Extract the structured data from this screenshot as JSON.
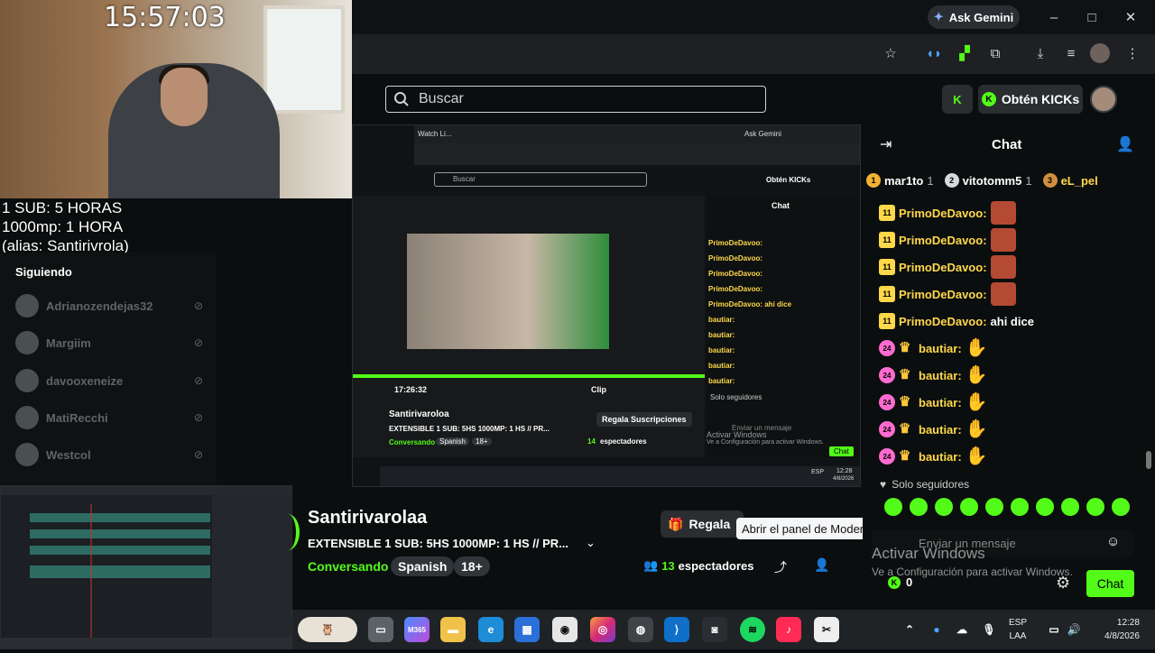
{
  "overlay": {
    "clock": "15:57:03",
    "line1": "1 SUB: 5 HORAS",
    "line2": "1000mp: 1 HORA",
    "line3": "(alias: Santirivrola)"
  },
  "sidebar": {
    "title": "Siguiendo",
    "items": [
      {
        "name": "Adrianozendejas32"
      },
      {
        "name": "Margiim"
      },
      {
        "name": "davooxeneize"
      },
      {
        "name": "MatiRecchi"
      },
      {
        "name": "Westcol"
      }
    ]
  },
  "browser": {
    "ask_gemini": "Ask Gemini",
    "window_controls": [
      "–",
      "□",
      "✕"
    ]
  },
  "kick": {
    "search_placeholder": "Buscar",
    "obten_kicks": "Obtén KICKs"
  },
  "nested": {
    "tab_label": "Watch Li...",
    "search": "Buscar",
    "ask_gemini": "Ask Gemini",
    "obten_kicks": "Obtén KICKs",
    "chat_title": "Chat",
    "streamer": "Santirivaroloa",
    "title": "EXTENSIBLE 1 SUB: 5HS 1000MP: 1 HS // PR...",
    "category": "Conversando",
    "language": "Spanish",
    "age": "18+",
    "viewers": "14",
    "viewers_label": "espectadores",
    "gift": "Regala Suscripciones",
    "time": "17:26:32",
    "clip": "Clip",
    "chat_messages": [
      "PrimoDeDavoo:",
      "PrimoDeDavoo:",
      "PrimoDeDavoo:",
      "PrimoDeDavoo:",
      "PrimoDeDavoo: ahi dice",
      "bautiar:",
      "bautiar:",
      "bautiar:",
      "bautiar:",
      "bautiar:"
    ],
    "followers_only": "Solo seguidores",
    "send_placeholder": "Enviar un mensaje",
    "activate": "Activar Windows",
    "activate2": "Ve a Configuración para activar Windows.",
    "send": "Chat",
    "tray_lang": "ESP",
    "tray_time": "12:28",
    "tray_date": "4/8/2026"
  },
  "stream": {
    "streamer": "Santirivarolaa",
    "title": "EXTENSIBLE  1 SUB: 5HS  1000MP: 1 HS // PR...",
    "category": "Conversando",
    "tags": [
      "Spanish",
      "18+"
    ],
    "gift": "Regala",
    "tooltip": "Abrir el panel de Moderación",
    "viewers": "13",
    "viewers_label": "espectadores"
  },
  "chat": {
    "title": "Chat",
    "leaderboard": [
      {
        "rank": "1",
        "name": "mar1to",
        "count": "1",
        "color": "#f2b230"
      },
      {
        "rank": "2",
        "name": "vitotomm5",
        "count": "1",
        "color": "#d5d9dc"
      },
      {
        "rank": "3",
        "name": "eL_pel",
        "count": "",
        "color": "#d08f3c"
      }
    ],
    "messages": [
      {
        "user": "PrimoDeDavoo:",
        "badge": "11",
        "type": "sub",
        "text": ""
      },
      {
        "user": "PrimoDeDavoo:",
        "badge": "11",
        "type": "sub",
        "text": ""
      },
      {
        "user": "PrimoDeDavoo:",
        "badge": "11",
        "type": "sub",
        "text": ""
      },
      {
        "user": "PrimoDeDavoo:",
        "badge": "11",
        "type": "sub",
        "text": ""
      },
      {
        "user": "PrimoDeDavoo:",
        "badge": "11",
        "type": "sub",
        "text": "ahi dice"
      },
      {
        "user": "bautiar:",
        "badge": "24",
        "type": "pink",
        "text": ""
      },
      {
        "user": "bautiar:",
        "badge": "24",
        "type": "pink",
        "text": ""
      },
      {
        "user": "bautiar:",
        "badge": "24",
        "type": "pink",
        "text": ""
      },
      {
        "user": "bautiar:",
        "badge": "24",
        "type": "pink",
        "text": ""
      },
      {
        "user": "bautiar:",
        "badge": "24",
        "type": "pink",
        "text": ""
      }
    ],
    "followers_only": "Solo seguidores",
    "input_placeholder": "Enviar un mensaje",
    "activate_title": "Activar Windows",
    "activate_sub": "Ve a Configuración para activar Windows.",
    "kicks_count": "0",
    "send_label": "Chat"
  },
  "taskbar": {
    "m365": "M365",
    "lang_top": "ESP",
    "lang_bottom": "LAA",
    "time": "12:28",
    "date": "4/8/2026"
  },
  "colors": {
    "kick_green": "#53fc18",
    "sub_badge": "#ffd84a",
    "pink_badge": "#ff6bd0"
  }
}
